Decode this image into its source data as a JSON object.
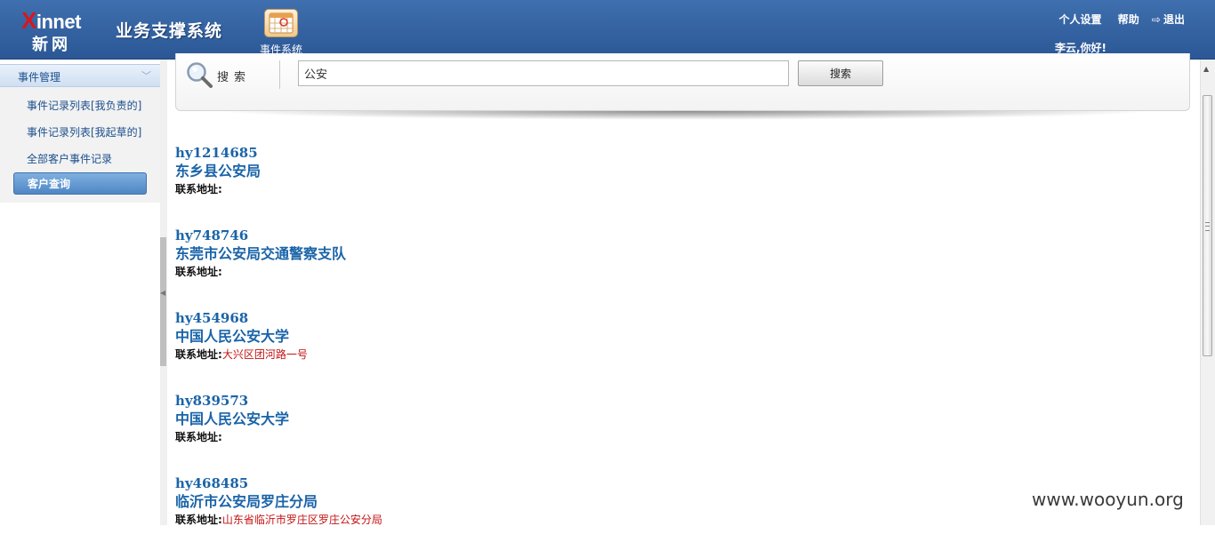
{
  "header": {
    "logo_text": "Xinnet",
    "logo_cn": "新网",
    "system_title": "业务支撑系统",
    "event_system_label": "事件系统",
    "links": {
      "settings": "个人设置",
      "help": "帮助",
      "logout": "退出"
    },
    "greeting": "李云,你好!"
  },
  "sidebar": {
    "section_title": "事件管理",
    "items": [
      {
        "label": "事件记录列表[我负责的]"
      },
      {
        "label": "事件记录列表[我起草的]"
      },
      {
        "label": "全部客户事件记录"
      },
      {
        "label": "客户查询"
      }
    ]
  },
  "search": {
    "label": "搜索",
    "value": "公安",
    "button": "搜索"
  },
  "results": [
    {
      "code": "hy1214685",
      "name": "东乡县公安局",
      "addr_label": "联系地址:",
      "addr": ""
    },
    {
      "code": "hy748746",
      "name": "东莞市公安局交通警察支队",
      "addr_label": "联系地址:",
      "addr": ""
    },
    {
      "code": "hy454968",
      "name": "中国人民公安大学",
      "addr_label": "联系地址:",
      "addr": "大兴区团河路一号"
    },
    {
      "code": "hy839573",
      "name": "中国人民公安大学",
      "addr_label": "联系地址:",
      "addr": ""
    },
    {
      "code": "hy468485",
      "name": "临沂市公安局罗庄分局",
      "addr_label": "联系地址:",
      "addr": "山东省临沂市罗庄区罗庄公安分局"
    }
  ],
  "watermark": "www.wooyun.org",
  "colors": {
    "header_blue": "#2f5f9f",
    "link_blue": "#1a64a8",
    "address_red": "#c41212",
    "active_item": "#5a90cc"
  },
  "icons": {
    "search": "magnifier-icon",
    "event_system": "calendar-icon",
    "logout": "logout-icon"
  }
}
